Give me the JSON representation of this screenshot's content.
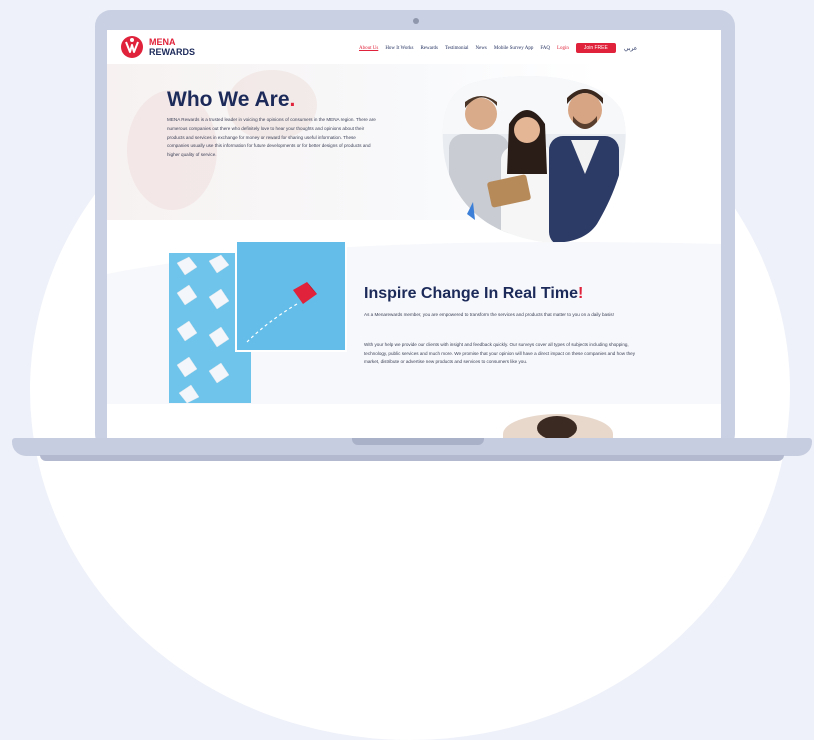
{
  "brand": {
    "name_line1": "MENA",
    "name_line2": "REWARDS",
    "colors": {
      "primary": "#1c2a5a",
      "accent": "#e0223a",
      "sky": "#63bde8"
    }
  },
  "nav": {
    "items": [
      {
        "label": "About Us",
        "active": true
      },
      {
        "label": "How It Works"
      },
      {
        "label": "Rewards"
      },
      {
        "label": "Testimonial"
      },
      {
        "label": "News"
      },
      {
        "label": "Mobile Survey App"
      },
      {
        "label": "FAQ"
      },
      {
        "label": "Login"
      }
    ],
    "join_label": "Join FREE",
    "language_label": "عربي"
  },
  "hero": {
    "title": "Who We Are",
    "title_dot": ".",
    "body": "MENA Rewards is a trusted leader in voicing the opinions of consumers in the MENA region. There are numerous companies out there who definitely love to hear your thoughts and opinions about their products and services in exchange for money or reward for sharing useful information. These companies usually use this information for future developments or for better designs of products and higher quality of service."
  },
  "inspire": {
    "title": "Inspire Change In Real Time",
    "title_mark": "!",
    "body1": "As a Menarewards member, you are empowered to transform the services and products that matter to you on a daily basis!",
    "body2": "With your help we provide our clients with insight and feedback quickly. Our surveys cover all types of subjects including shopping, technology, public services and much more. We promise that your opinion will have a direct impact on these companies and how they market, distribute or advertise new products and services to consumers like you."
  }
}
